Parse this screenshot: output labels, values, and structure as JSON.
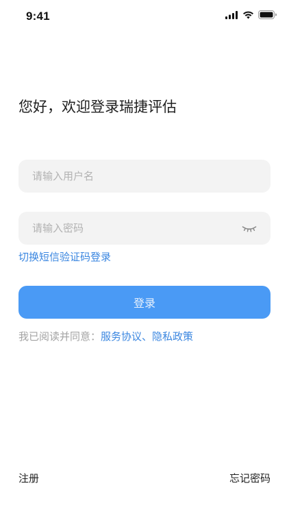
{
  "status_bar": {
    "time": "9:41",
    "icons": [
      "cellular-signal-icon",
      "wifi-icon",
      "battery-icon"
    ]
  },
  "greeting": "您好，欢迎登录瑞捷评估",
  "username": {
    "value": "",
    "placeholder": "请输入用户名"
  },
  "password": {
    "value": "",
    "placeholder": "请输入密码",
    "toggle_icon": "eye-closed-icon"
  },
  "switch_sms_login": "切换短信验证码登录",
  "login_button": "登录",
  "agreement": {
    "prefix": "我已阅读并同意：",
    "service": "服务协议",
    "separator": "、",
    "privacy": "隐私政策"
  },
  "footer": {
    "register": "注册",
    "forgot_password": "忘记密码"
  },
  "colors": {
    "accent": "#4a9af5",
    "link": "#3a86e0",
    "field_bg": "#f3f3f3"
  }
}
